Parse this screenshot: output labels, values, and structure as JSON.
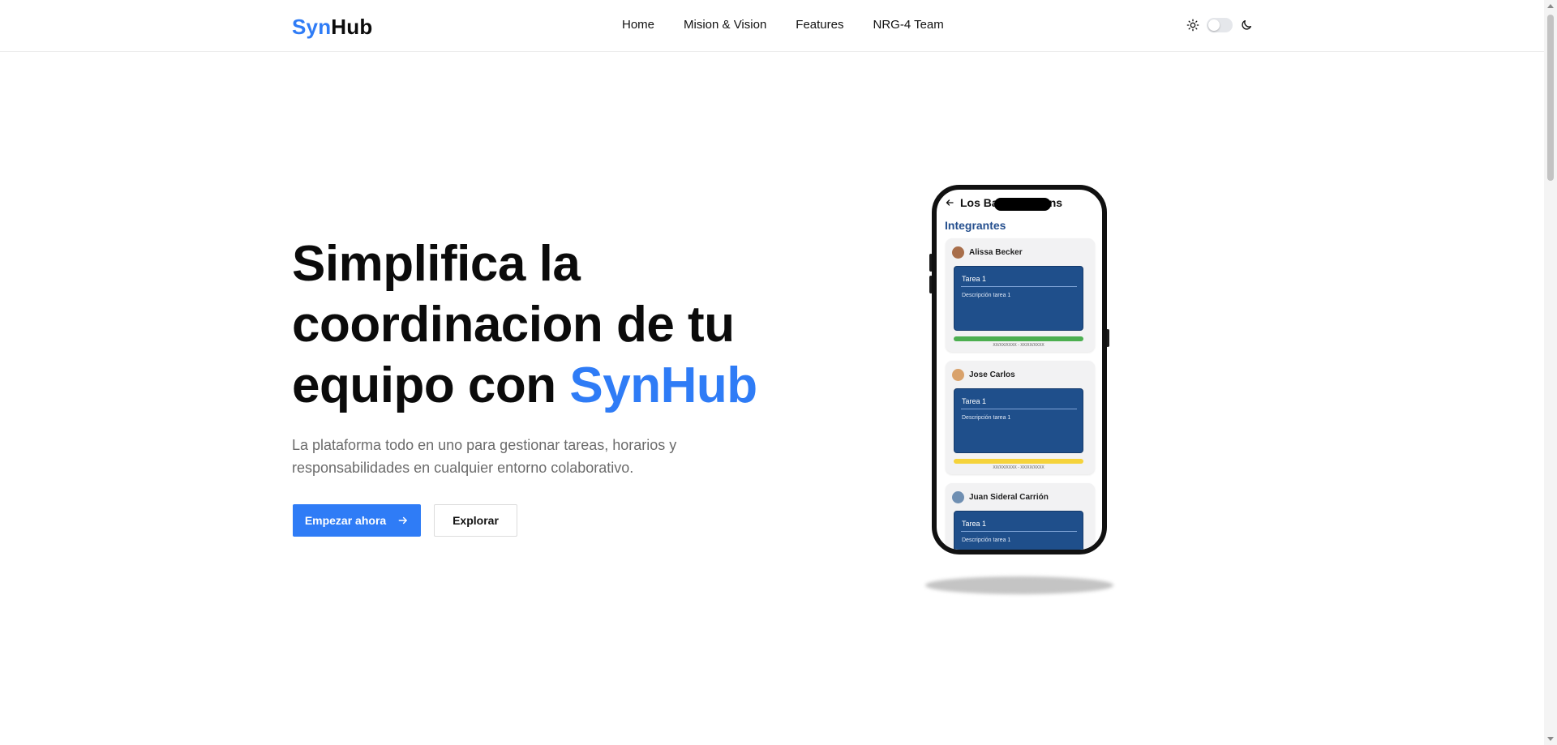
{
  "brand": {
    "part1": "Syn",
    "part2": "Hub",
    "accent_color": "#2f7cf6"
  },
  "nav": {
    "items": [
      "Home",
      "Mision & Vision",
      "Features",
      "NRG-4 Team"
    ]
  },
  "theme_toggle": {
    "light_icon": "sun-icon",
    "dark_icon": "moon-icon",
    "state": "off"
  },
  "hero": {
    "title_part1": "Simplifica la coordinacion de tu equipo con ",
    "title_accent": "SynHub",
    "subtitle": "La plataforma todo en uno para gestionar tareas, horarios y responsabilidades en cualquier entorno colaborativo.",
    "primary_button": "Empezar ahora",
    "primary_icon": "arrow-right-icon",
    "secondary_button": "Explorar"
  },
  "phone": {
    "header_title": "Los Ba",
    "header_title_end": "ns",
    "section_title": "Integrantes",
    "members": [
      {
        "name": "Alissa Becker",
        "task_title": "Tarea 1",
        "task_desc": "Descripción tarea 1",
        "dates": "XX/XX/XXXX - XX/XX/XXXX",
        "status_color": "#4caf50"
      },
      {
        "name": "Jose Carlos",
        "task_title": "Tarea 1",
        "task_desc": "Descripción tarea 1",
        "dates": "XX/XX/XXXX - XX/XX/XXXX",
        "status_color": "#f5d33b"
      },
      {
        "name": "Juan Sideral Carrión",
        "task_title": "Tarea 1",
        "task_desc": "Descripción tarea 1",
        "dates": "",
        "status_color": "#1f4f8b"
      }
    ]
  }
}
